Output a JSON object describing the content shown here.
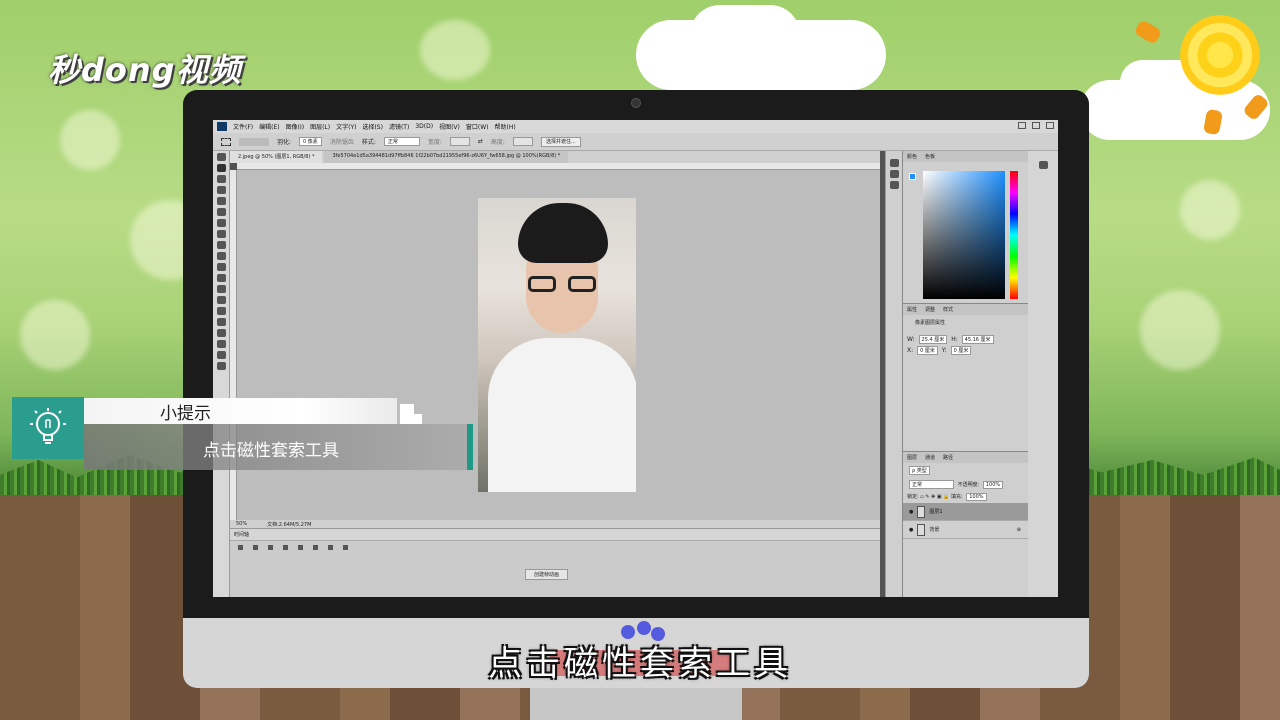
{
  "logo": {
    "text": "秒dong视频"
  },
  "photoshop": {
    "menu": [
      "文件(F)",
      "编辑(E)",
      "图像(I)",
      "图层(L)",
      "文字(Y)",
      "选择(S)",
      "滤镜(T)",
      "3D(D)",
      "视图(V)",
      "窗口(W)",
      "帮助(H)"
    ],
    "options": {
      "feather_label": "羽化:",
      "feather_value": "0 像素",
      "antialias": "消除锯齿",
      "style_label": "样式:",
      "style_value": "正常",
      "width_label": "宽度:",
      "height_label": "高度:",
      "refine_button": "选择并遮住..."
    },
    "tabs": [
      "2.jpeg @ 50% (图层1, RGB/8) *",
      "3fe5704e1d5a394481d97ffb846 1f22b07bd21955ef96-z6U6Y_fw658.jpg @ 100%(RGB/8) *"
    ],
    "status": {
      "zoom": "50%",
      "doc": "文档:2.64M/5.27M"
    },
    "timeline": {
      "title": "时间轴",
      "create_button": "创建帧动画"
    },
    "color_panel": {
      "tabs": [
        "颜色",
        "色板"
      ]
    },
    "props_panel": {
      "tabs": [
        "属性",
        "调整",
        "样式"
      ],
      "title": "像素图层属性",
      "w_label": "W:",
      "w_value": "25.4 厘米",
      "h_label": "H:",
      "h_value": "45.16 厘米",
      "x_label": "X:",
      "x_value": "0 厘米",
      "y_label": "Y:",
      "y_value": "0 厘米"
    },
    "layers_panel": {
      "tabs": [
        "图层",
        "通道",
        "路径"
      ],
      "kind": "ρ 类型",
      "mode": "正常",
      "opacity_label": "不透明度:",
      "opacity": "100%",
      "lock_label": "锁定:",
      "fill_label": "填充:",
      "fill": "100%",
      "layers": [
        "图层1",
        "背景"
      ]
    }
  },
  "tip": {
    "title": "小提示",
    "text": "点击磁性套索工具"
  },
  "subtitle": "点击磁性套索工具",
  "colors": {
    "accent": "#2a9d8f",
    "foreground_color": "#1e90ff"
  }
}
